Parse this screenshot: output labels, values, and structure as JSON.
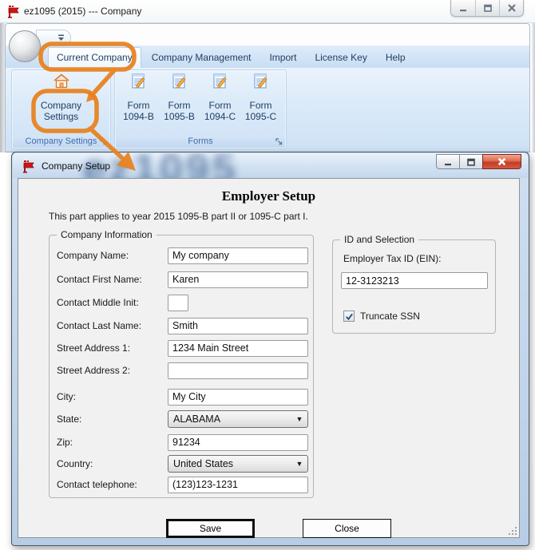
{
  "window": {
    "title": "ez1095 (2015) --- Company"
  },
  "ribbon": {
    "tabs": [
      {
        "label": "Current Company",
        "active": true
      },
      {
        "label": "Company Management",
        "active": false
      },
      {
        "label": "Import",
        "active": false
      },
      {
        "label": "License Key",
        "active": false
      },
      {
        "label": "Help",
        "active": false
      }
    ],
    "company_settings_button": "Company Settings",
    "form_buttons": [
      "Form 1094-B",
      "Form 1095-B",
      "Form 1094-C",
      "Form 1095-C"
    ],
    "group_captions": {
      "company_settings": "Company Settings",
      "forms": "Forms"
    }
  },
  "dialog": {
    "title": "Company Setup",
    "watermark": "ez1095",
    "heading": "Employer Setup",
    "subtitle": "This part applies to year 2015 1095-B part II or 1095-C part I.",
    "company_information": {
      "legend": "Company Information",
      "company_name": {
        "label": "Company Name:",
        "value": "My company"
      },
      "contact_first_name": {
        "label": "Contact First Name:",
        "value": "Karen"
      },
      "contact_middle_init": {
        "label": "Contact Middle Init:",
        "value": ""
      },
      "contact_last_name": {
        "label": "Contact Last Name:",
        "value": "Smith"
      },
      "street_address_1": {
        "label": "Street Address 1:",
        "value": "1234 Main Street"
      },
      "street_address_2": {
        "label": "Street Address 2:",
        "value": ""
      },
      "city": {
        "label": "City:",
        "value": "My City"
      },
      "state": {
        "label": "State:",
        "value": "ALABAMA"
      },
      "zip": {
        "label": "Zip:",
        "value": "91234"
      },
      "country": {
        "label": "Country:",
        "value": "United States"
      },
      "contact_telephone": {
        "label": "Contact telephone:",
        "value": "(123)123-1231"
      }
    },
    "id_and_selection": {
      "legend": "ID and Selection",
      "ein_label": "Employer Tax ID (EIN):",
      "ein_value": "12-3123213",
      "truncate_ssn_label": "Truncate SSN",
      "truncate_ssn_checked": true
    },
    "buttons": {
      "save": "Save",
      "close": "Close"
    }
  },
  "colors": {
    "annotation_orange": "#e8811d",
    "close_button_red": "#c23c27",
    "tab_text": "#1e3c5f",
    "group_caption": "#3f6dae",
    "dialog_frame": "#b7cde5"
  }
}
